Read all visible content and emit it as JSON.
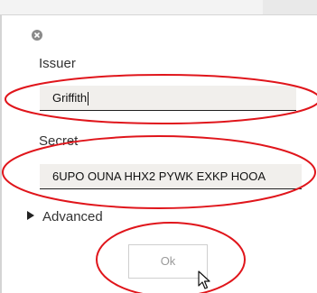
{
  "dialog": {
    "issuer": {
      "label": "Issuer",
      "value": "Griffith"
    },
    "secret": {
      "label": "Secret",
      "value": "6UPO OUNA HHX2 PYWK EXKP HOOA"
    },
    "advanced_label": "Advanced",
    "ok_label": "Ok"
  },
  "annotation": {
    "color": "#e0151b"
  }
}
